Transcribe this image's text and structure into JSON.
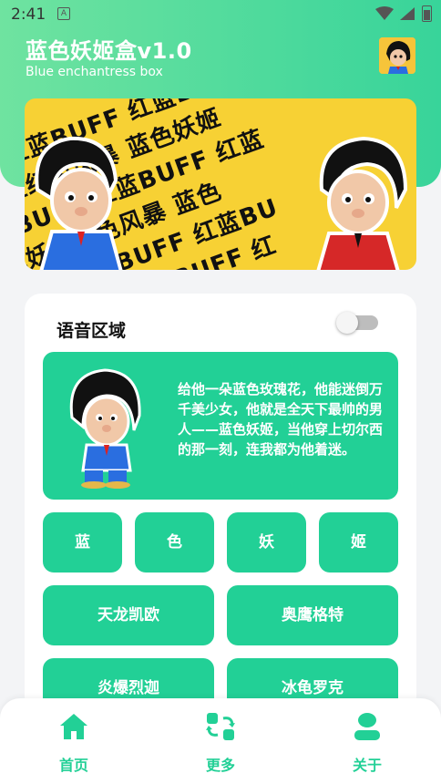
{
  "status_bar": {
    "time": "2:41",
    "app_icon": "A"
  },
  "header": {
    "title": "蓝色妖姬盒v1.0",
    "subtitle": "Blue enchantress box"
  },
  "banner": {
    "lines": [
      "UFF 红蓝BUFF 红蓝BUFF",
      "色妖姬红色风暴 蓝色妖姬",
      "红蓝BUFF 红蓝BUFF 红蓝",
      "蓝色妖姬红色风暴 蓝色",
      "BUFF 红蓝BUFF 红蓝BU",
      "红蓝BUFF 红蓝BUFF 红"
    ]
  },
  "voice_section": {
    "title": "语音区域",
    "toggle_on": false,
    "intro": "给他一朵蓝色玫瑰花，他能迷倒万千美少女，他就是全天下最帅的男人——蓝色妖姬，当他穿上切尔西的那一刻，连我都为他着迷。",
    "buttons": [
      "蓝",
      "色",
      "妖",
      "姬",
      "天龙凯欧",
      "奥鹰格特",
      "炎爆烈迦",
      "冰龟罗克"
    ]
  },
  "bottom_nav": {
    "items": [
      {
        "label": "首页",
        "icon": "home-icon"
      },
      {
        "label": "更多",
        "icon": "refresh-icon"
      },
      {
        "label": "关于",
        "icon": "user-icon"
      }
    ]
  },
  "colors": {
    "accent": "#22d096",
    "header_gradient_start": "#6fe3a0",
    "header_gradient_end": "#38d49a",
    "banner_yellow": "#f7d134"
  }
}
